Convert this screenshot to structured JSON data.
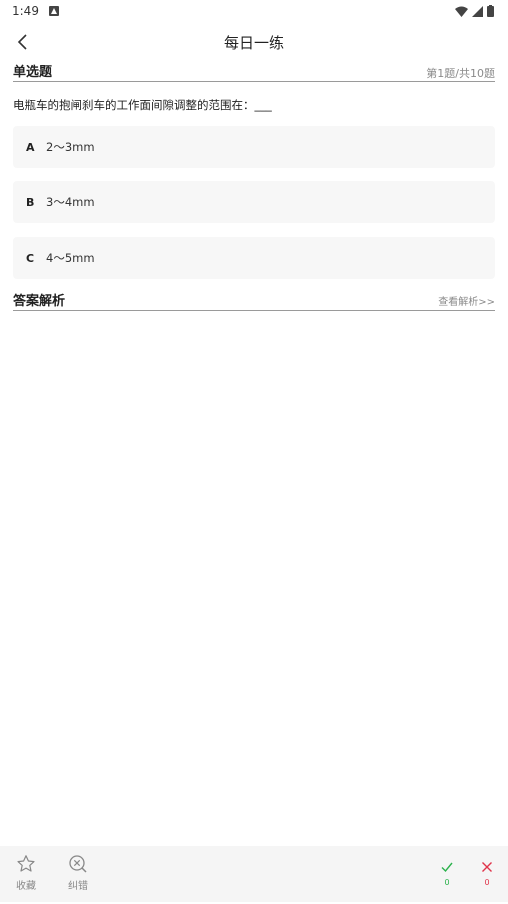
{
  "status_bar": {
    "time": "1:49"
  },
  "app_bar": {
    "title": "每日一练"
  },
  "question_section": {
    "heading": "单选题",
    "progress": "第1题/共10题",
    "question_text": "电瓶车的抱闸刹车的工作面间隙调整的范围在：___"
  },
  "options": [
    {
      "letter": "A",
      "text": "2～3mm"
    },
    {
      "letter": "B",
      "text": "3～4mm"
    },
    {
      "letter": "C",
      "text": "4～5mm"
    }
  ],
  "analysis_section": {
    "heading": "答案解析",
    "link": "查看解析>>"
  },
  "bottom_bar": {
    "favorite_label": "收藏",
    "report_label": "纠错",
    "correct_count": "0",
    "wrong_count": "0",
    "correct_color": "#2bb24c",
    "wrong_color": "#e0344a"
  }
}
